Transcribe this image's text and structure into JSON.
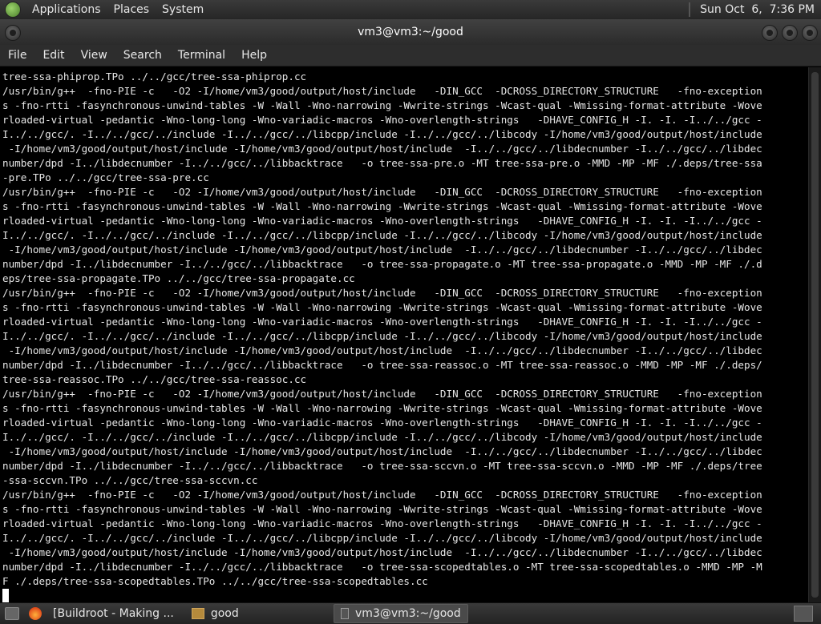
{
  "topbar": {
    "menus": [
      "Applications",
      "Places",
      "System"
    ],
    "clock": "Sun Oct  6,  7:36 PM"
  },
  "window": {
    "title": "vm3@vm3:~/good"
  },
  "menubar": {
    "items": [
      "File",
      "Edit",
      "View",
      "Search",
      "Terminal",
      "Help"
    ]
  },
  "terminal": {
    "lines": [
      "tree-ssa-phiprop.TPo ../../gcc/tree-ssa-phiprop.cc",
      "/usr/bin/g++  -fno-PIE -c   -O2 -I/home/vm3/good/output/host/include   -DIN_GCC  -DCROSS_DIRECTORY_STRUCTURE   -fno-exception",
      "s -fno-rtti -fasynchronous-unwind-tables -W -Wall -Wno-narrowing -Wwrite-strings -Wcast-qual -Wmissing-format-attribute -Wove",
      "rloaded-virtual -pedantic -Wno-long-long -Wno-variadic-macros -Wno-overlength-strings   -DHAVE_CONFIG_H -I. -I. -I../../gcc -",
      "I../../gcc/. -I../../gcc/../include -I../../gcc/../libcpp/include -I../../gcc/../libcody -I/home/vm3/good/output/host/include",
      " -I/home/vm3/good/output/host/include -I/home/vm3/good/output/host/include  -I../../gcc/../libdecnumber -I../../gcc/../libdec",
      "number/dpd -I../libdecnumber -I../../gcc/../libbacktrace   -o tree-ssa-pre.o -MT tree-ssa-pre.o -MMD -MP -MF ./.deps/tree-ssa",
      "-pre.TPo ../../gcc/tree-ssa-pre.cc",
      "/usr/bin/g++  -fno-PIE -c   -O2 -I/home/vm3/good/output/host/include   -DIN_GCC  -DCROSS_DIRECTORY_STRUCTURE   -fno-exception",
      "s -fno-rtti -fasynchronous-unwind-tables -W -Wall -Wno-narrowing -Wwrite-strings -Wcast-qual -Wmissing-format-attribute -Wove",
      "rloaded-virtual -pedantic -Wno-long-long -Wno-variadic-macros -Wno-overlength-strings   -DHAVE_CONFIG_H -I. -I. -I../../gcc -",
      "I../../gcc/. -I../../gcc/../include -I../../gcc/../libcpp/include -I../../gcc/../libcody -I/home/vm3/good/output/host/include",
      " -I/home/vm3/good/output/host/include -I/home/vm3/good/output/host/include  -I../../gcc/../libdecnumber -I../../gcc/../libdec",
      "number/dpd -I../libdecnumber -I../../gcc/../libbacktrace   -o tree-ssa-propagate.o -MT tree-ssa-propagate.o -MMD -MP -MF ./.d",
      "eps/tree-ssa-propagate.TPo ../../gcc/tree-ssa-propagate.cc",
      "/usr/bin/g++  -fno-PIE -c   -O2 -I/home/vm3/good/output/host/include   -DIN_GCC  -DCROSS_DIRECTORY_STRUCTURE   -fno-exception",
      "s -fno-rtti -fasynchronous-unwind-tables -W -Wall -Wno-narrowing -Wwrite-strings -Wcast-qual -Wmissing-format-attribute -Wove",
      "rloaded-virtual -pedantic -Wno-long-long -Wno-variadic-macros -Wno-overlength-strings   -DHAVE_CONFIG_H -I. -I. -I../../gcc -",
      "I../../gcc/. -I../../gcc/../include -I../../gcc/../libcpp/include -I../../gcc/../libcody -I/home/vm3/good/output/host/include",
      " -I/home/vm3/good/output/host/include -I/home/vm3/good/output/host/include  -I../../gcc/../libdecnumber -I../../gcc/../libdec",
      "number/dpd -I../libdecnumber -I../../gcc/../libbacktrace   -o tree-ssa-reassoc.o -MT tree-ssa-reassoc.o -MMD -MP -MF ./.deps/",
      "tree-ssa-reassoc.TPo ../../gcc/tree-ssa-reassoc.cc",
      "/usr/bin/g++  -fno-PIE -c   -O2 -I/home/vm3/good/output/host/include   -DIN_GCC  -DCROSS_DIRECTORY_STRUCTURE   -fno-exception",
      "s -fno-rtti -fasynchronous-unwind-tables -W -Wall -Wno-narrowing -Wwrite-strings -Wcast-qual -Wmissing-format-attribute -Wove",
      "rloaded-virtual -pedantic -Wno-long-long -Wno-variadic-macros -Wno-overlength-strings   -DHAVE_CONFIG_H -I. -I. -I../../gcc -",
      "I../../gcc/. -I../../gcc/../include -I../../gcc/../libcpp/include -I../../gcc/../libcody -I/home/vm3/good/output/host/include",
      " -I/home/vm3/good/output/host/include -I/home/vm3/good/output/host/include  -I../../gcc/../libdecnumber -I../../gcc/../libdec",
      "number/dpd -I../libdecnumber -I../../gcc/../libbacktrace   -o tree-ssa-sccvn.o -MT tree-ssa-sccvn.o -MMD -MP -MF ./.deps/tree",
      "-ssa-sccvn.TPo ../../gcc/tree-ssa-sccvn.cc",
      "/usr/bin/g++  -fno-PIE -c   -O2 -I/home/vm3/good/output/host/include   -DIN_GCC  -DCROSS_DIRECTORY_STRUCTURE   -fno-exception",
      "s -fno-rtti -fasynchronous-unwind-tables -W -Wall -Wno-narrowing -Wwrite-strings -Wcast-qual -Wmissing-format-attribute -Wove",
      "rloaded-virtual -pedantic -Wno-long-long -Wno-variadic-macros -Wno-overlength-strings   -DHAVE_CONFIG_H -I. -I. -I../../gcc -",
      "I../../gcc/. -I../../gcc/../include -I../../gcc/../libcpp/include -I../../gcc/../libcody -I/home/vm3/good/output/host/include",
      " -I/home/vm3/good/output/host/include -I/home/vm3/good/output/host/include  -I../../gcc/../libdecnumber -I../../gcc/../libdec",
      "number/dpd -I../libdecnumber -I../../gcc/../libbacktrace   -o tree-ssa-scopedtables.o -MT tree-ssa-scopedtables.o -MMD -MP -M",
      "F ./.deps/tree-ssa-scopedtables.TPo ../../gcc/tree-ssa-scopedtables.cc"
    ]
  },
  "taskbar": {
    "tasks": [
      "[Buildroot - Making ...",
      "good",
      "vm3@vm3:~/good"
    ],
    "active_task": 2
  }
}
